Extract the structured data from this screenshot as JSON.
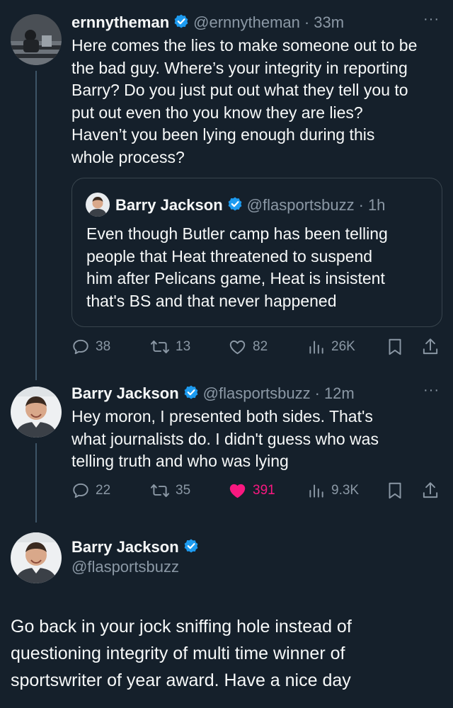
{
  "colors": {
    "background": "#15202b",
    "text": "#f7f9f9",
    "secondary": "#8b98a5",
    "verified": "#1d9bf0",
    "like_active": "#f91880",
    "border": "#38444d"
  },
  "tweet1": {
    "author_name": "ernnytheman",
    "handle": "@ernnytheman",
    "time": "33m",
    "lines": [
      "Here comes the lies to make someone out to be",
      "the bad guy. Where’s your integrity in reporting",
      "Barry? Do you just put out what they tell you to",
      "put out even tho you know they are lies?",
      "Haven’t you been lying enough during this",
      "whole process?"
    ],
    "quote": {
      "author_name": "Barry Jackson",
      "handle": "@flasportsbuzz",
      "time": "1h",
      "lines": [
        "Even though Butler camp has been telling",
        "people that Heat threatened to suspend",
        "him after Pelicans game, Heat is insistent",
        "that's BS and that never happened"
      ]
    },
    "stats": {
      "replies": "38",
      "reposts": "13",
      "likes": "82",
      "views": "26K"
    }
  },
  "tweet2": {
    "author_name": "Barry Jackson",
    "handle": "@flasportsbuzz",
    "time": "12m",
    "lines": [
      "Hey moron, I presented both sides. That's",
      "what journalists do. I didn't guess who was",
      "telling truth and who was lying"
    ],
    "stats": {
      "replies": "22",
      "reposts": "35",
      "likes": "391",
      "views": "9.3K"
    }
  },
  "tweet3": {
    "author_name": "Barry Jackson",
    "handle": "@flasportsbuzz",
    "lines": [
      "Go back in your jock sniffing hole instead of",
      "questioning integrity of multi time winner of",
      "sportswriter of year award. Have a nice day"
    ]
  },
  "icons": {
    "verified": "verified-badge-icon",
    "more": "more-icon",
    "reply": "reply-icon",
    "repost": "repost-icon",
    "like": "heart-icon",
    "views": "views-icon",
    "bookmark": "bookmark-icon",
    "share": "share-icon"
  }
}
